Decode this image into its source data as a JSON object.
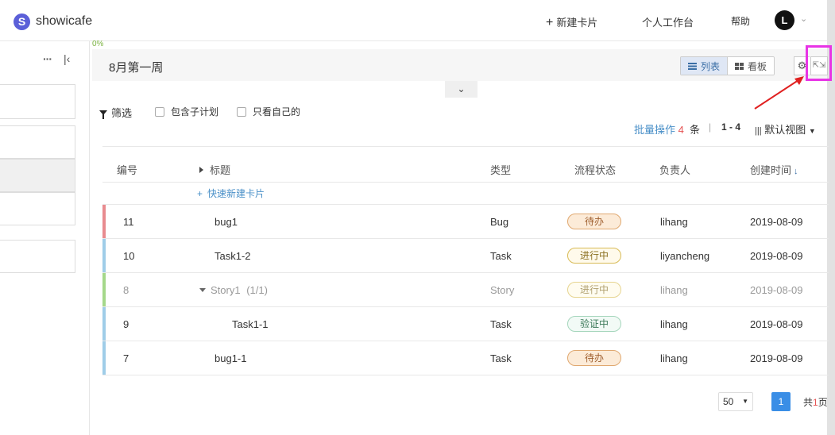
{
  "app": {
    "logo_letter": "S",
    "name": "showicafe"
  },
  "topnav": {
    "new_card": "新建卡片",
    "workspace": "个人工作台",
    "help": "帮助",
    "avatar_letter": "L"
  },
  "left_panel": {
    "more": "···"
  },
  "plan": {
    "progress": "0%",
    "title": "8月第一周",
    "view_list": "列表",
    "view_board": "看板"
  },
  "filters": {
    "filter_label": "筛选",
    "include_subplan": "包含子计划",
    "only_mine": "只看自己的"
  },
  "toolbar": {
    "batch_label": "批量操作",
    "batch_count": "4",
    "batch_unit": "条",
    "separator": "|",
    "range": "1 - 4",
    "default_view": "默认视图"
  },
  "table": {
    "headers": {
      "id": "编号",
      "title": "标题",
      "type": "类型",
      "status": "流程状态",
      "assignee": "负责人",
      "created": "创建时间"
    },
    "quick_add": "快速新建卡片",
    "rows": [
      {
        "id": "11",
        "title": "bug1",
        "type": "Bug",
        "status": "待办",
        "assignee": "lihang",
        "created": "2019-08-09"
      },
      {
        "id": "10",
        "title": "Task1-2",
        "type": "Task",
        "status": "进行中",
        "assignee": "liyancheng",
        "created": "2019-08-09"
      },
      {
        "id": "8",
        "title": "Story1",
        "title_count": "(1/1)",
        "type": "Story",
        "status": "进行中",
        "assignee": "lihang",
        "created": "2019-08-09"
      },
      {
        "id": "9",
        "title": "Task1-1",
        "type": "Task",
        "status": "验证中",
        "assignee": "lihang",
        "created": "2019-08-09"
      },
      {
        "id": "7",
        "title": "bug1-1",
        "type": "Task",
        "status": "待办",
        "assignee": "lihang",
        "created": "2019-08-09"
      }
    ]
  },
  "pagination": {
    "page_size": "50",
    "current_page": "1",
    "total_prefix": "共",
    "total_pages": "1",
    "total_suffix": "页"
  },
  "colors": {
    "bug": "#e88b8f",
    "task": "#9fcde8",
    "story": "#a5d88a",
    "todo_bg": "#fcebd8",
    "todo_border": "#e0a870",
    "progress_bg": "#fffaeb",
    "progress_border": "#d8bb56",
    "verify_bg": "#f2faf6",
    "verify_border": "#a5d6bc",
    "highlight": "#e834e6"
  }
}
